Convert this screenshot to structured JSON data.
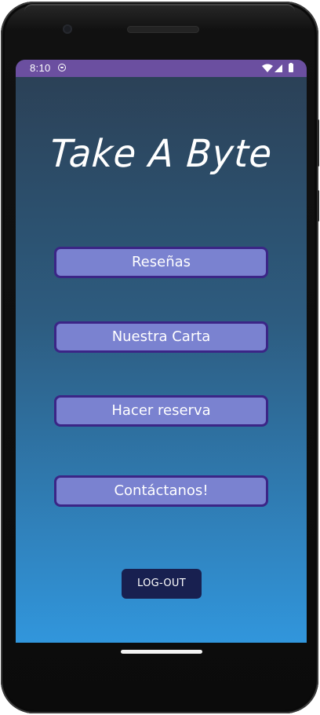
{
  "status_bar": {
    "time": "8:10",
    "background_color": "#6b4fa0",
    "icons": [
      "app-notification-icon",
      "wifi-icon",
      "cell-signal-icon",
      "battery-icon"
    ]
  },
  "app": {
    "title": "Take A Byte",
    "background_gradient": [
      "#2b3f54",
      "#3196dc"
    ]
  },
  "menu": {
    "buttons": [
      {
        "label": "Reseñas"
      },
      {
        "label": "Nuestra Carta"
      },
      {
        "label": "Hacer reserva"
      },
      {
        "label": "Contáctanos!"
      }
    ],
    "button_fill": "#7a82d0",
    "button_border": "#3b2586"
  },
  "logout": {
    "label": "LOG-OUT",
    "color": "#182050"
  }
}
